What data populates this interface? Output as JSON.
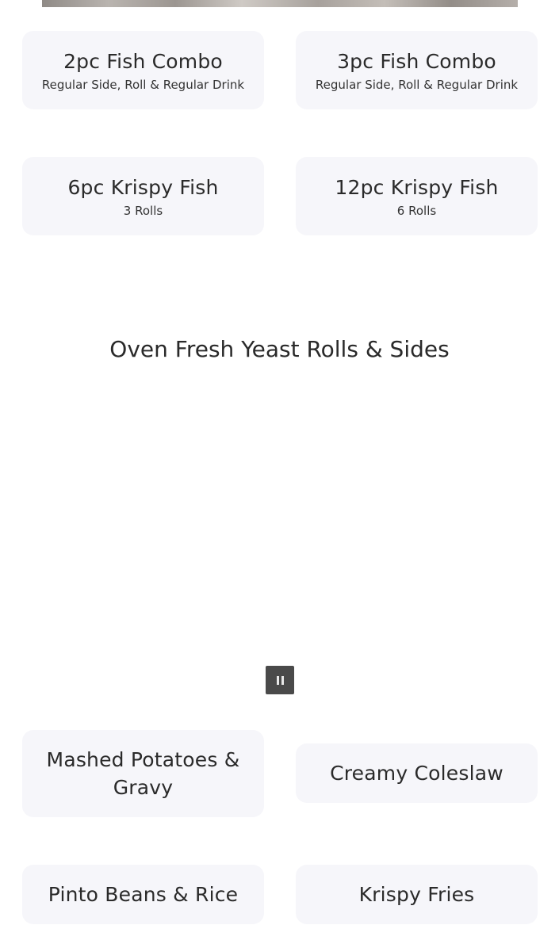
{
  "combos": [
    {
      "title": "2pc Fish Combo",
      "subtitle": "Regular Side, Roll & Regular Drink"
    },
    {
      "title": "3pc Fish Combo",
      "subtitle": "Regular Side, Roll & Regular Drink"
    },
    {
      "title": "6pc Krispy Fish",
      "subtitle": "3 Rolls"
    },
    {
      "title": "12pc Krispy Fish",
      "subtitle": "6 Rolls"
    }
  ],
  "section": {
    "heading": "Oven Fresh Yeast Rolls & Sides"
  },
  "media": {
    "control_icon": "pause-icon"
  },
  "sides": [
    {
      "title": "Mashed Potatoes & Gravy"
    },
    {
      "title": "Creamy Coleslaw"
    },
    {
      "title": "Pinto Beans & Rice"
    },
    {
      "title": "Krispy Fries"
    }
  ]
}
